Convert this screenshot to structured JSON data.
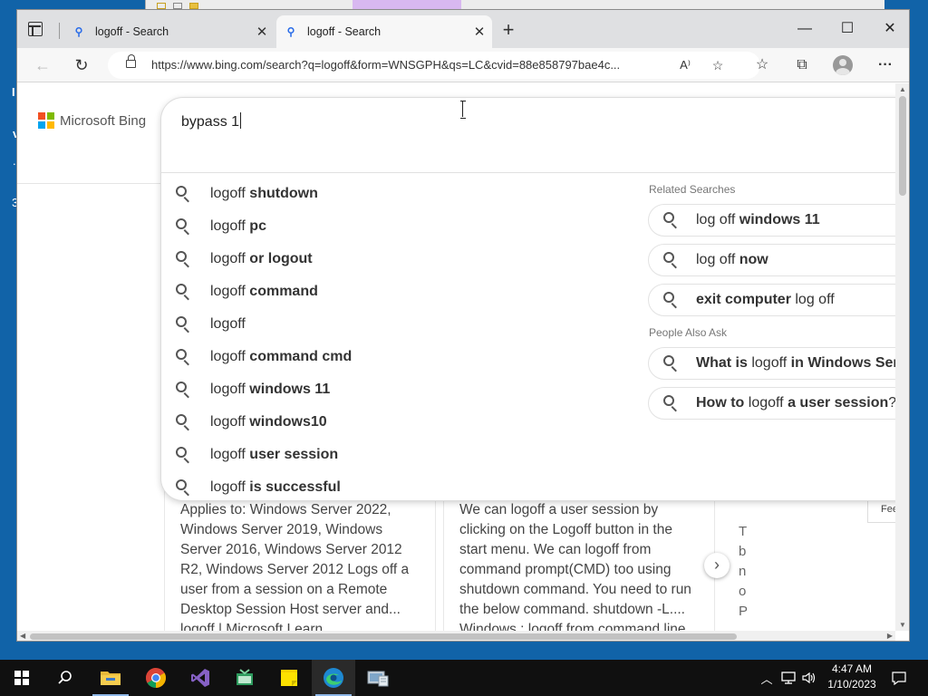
{
  "browser": {
    "tabs": [
      {
        "title": "logoff - Search",
        "active": false
      },
      {
        "title": "logoff - Search",
        "active": true
      }
    ],
    "new_tab_label": "+",
    "window_controls": {
      "minimize": "—",
      "maximize": "☐",
      "close": "✕"
    },
    "address_bar": {
      "url": "https://www.bing.com/search?q=logoff&form=WNSGPH&qs=LC&cvid=88e858797bae4c..."
    },
    "nav": {
      "back": "←",
      "refresh": "↻"
    },
    "toolbar_icons": [
      "read-aloud-icon",
      "add-favorite-icon",
      "favorites-icon",
      "collections-icon",
      "profile-icon",
      "more-icon"
    ]
  },
  "bing": {
    "logo_text": "Microsoft Bing",
    "brand_colors": [
      "#f25022",
      "#7fba00",
      "#00a4ef",
      "#ffb900"
    ],
    "search_query": "bypass 1",
    "suggestions": [
      {
        "prefix": "logoff ",
        "bold": "shutdown"
      },
      {
        "prefix": "logoff ",
        "bold": "pc"
      },
      {
        "prefix": "logoff ",
        "bold": "or logout"
      },
      {
        "prefix": "logoff ",
        "bold": "command"
      },
      {
        "prefix": "logoff",
        "bold": ""
      },
      {
        "prefix": "logoff ",
        "bold": "command cmd"
      },
      {
        "prefix": "logoff ",
        "bold": "windows 11"
      },
      {
        "prefix": "logoff ",
        "bold": "windows10"
      },
      {
        "prefix": "logoff ",
        "bold": "user session"
      },
      {
        "prefix": "logoff ",
        "bold": "is successful"
      }
    ],
    "related_label": "Related Searches",
    "related": [
      {
        "a": "log off ",
        "b": "windows 11",
        "c": ""
      },
      {
        "a": "log off ",
        "b": "now",
        "c": ""
      },
      {
        "a": "",
        "b": "exit computer",
        "c": " log off"
      }
    ],
    "people_label": "People Also Ask",
    "people": [
      {
        "b1": "What is ",
        "n": "logoff",
        "b2": " in Windows Serv"
      },
      {
        "b1": "How to ",
        "n": "logoff",
        "b2": " a user session",
        "tail": "?"
      }
    ],
    "cards": [
      {
        "lines": [
          "Applies to: Windows Server 2022,",
          "Windows Server 2019, Windows",
          "Server 2016, Windows Server 2012",
          "R2, Windows Server 2012 Logs off a",
          "user from a session on a Remote",
          "Desktop Session Host server and..."
        ],
        "footer": "logoff | Microsoft Learn"
      },
      {
        "lines": [
          "We can logoff a user session by",
          "clicking on the Logoff button in the",
          "start menu. We can logoff from",
          "command prompt(CMD) too using",
          "shutdown command. You need to run",
          "the below command. shutdown -L...."
        ],
        "footer": "Windows : logoff from command line"
      }
    ],
    "third_card_fragments": [
      "T",
      "b",
      "n",
      "o",
      "P"
    ],
    "feedback_label": "Fee",
    "carousel_next": "›"
  },
  "taskbar": {
    "apps": [
      "start-icon",
      "search-icon",
      "file-explorer-icon",
      "chrome-icon",
      "visual-studio-icon",
      "app-icon",
      "sticky-notes-icon",
      "edge-icon",
      "network-app-icon"
    ],
    "clock_time": "4:47 AM",
    "clock_date": "1/10/2023"
  }
}
